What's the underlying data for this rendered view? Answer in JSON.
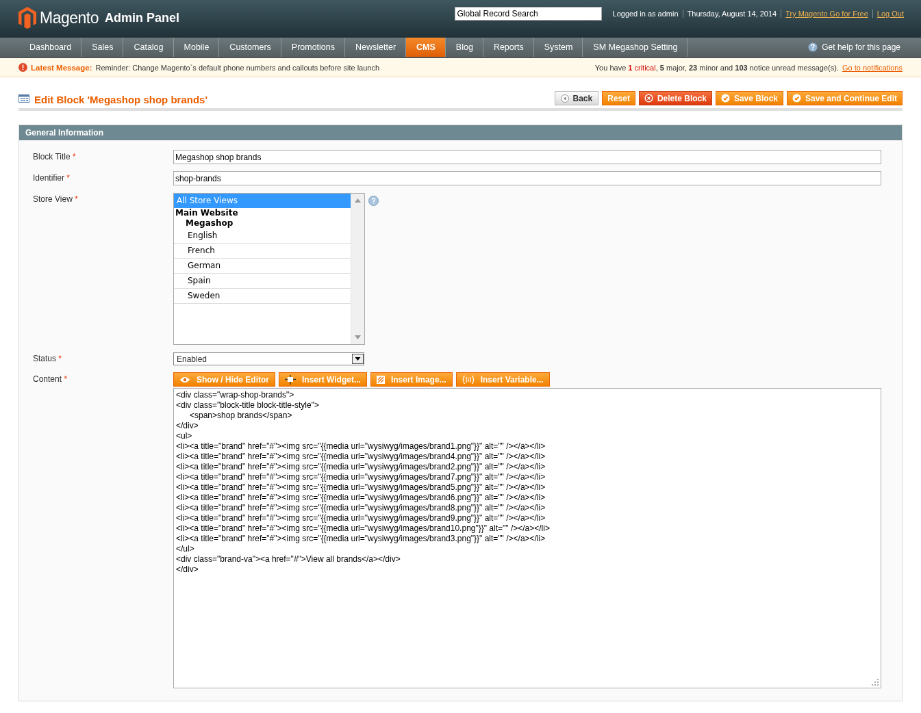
{
  "header": {
    "logo_text": "Magento",
    "logo_suffix": "Admin Panel",
    "search": {
      "placeholder": "Global Record Search"
    },
    "user_text": "Logged in as admin",
    "date": "Thursday, August 14, 2014",
    "links": [
      "Try Magento Go for Free",
      "Log Out"
    ]
  },
  "nav": {
    "items": [
      {
        "label": "Dashboard",
        "selected": false
      },
      {
        "label": "Sales",
        "selected": false
      },
      {
        "label": "Catalog",
        "selected": false
      },
      {
        "label": "Mobile",
        "selected": false
      },
      {
        "label": "Customers",
        "selected": false
      },
      {
        "label": "Promotions",
        "selected": false
      },
      {
        "label": "Newsletter",
        "selected": false
      },
      {
        "label": "CMS",
        "selected": true
      },
      {
        "label": "Blog",
        "selected": false
      },
      {
        "label": "Reports",
        "selected": false
      },
      {
        "label": "System",
        "selected": false
      },
      {
        "label": "SM Megashop Setting",
        "selected": false
      }
    ],
    "help": "Get help for this page"
  },
  "message_bar": {
    "label": "Latest Message:",
    "text": "Reminder: Change Magento`s default phone numbers and callouts before site launch",
    "summary_start": "You have ",
    "critical": "**1** critical",
    "summary_end": ", **5** major, **23** minor and **103** notice unread message(s).",
    "link": "Go to notifications"
  },
  "page": {
    "title": "Edit Block 'Megashop shop brands'",
    "buttons": [
      {
        "label": "Back",
        "kind": "back"
      },
      {
        "label": "Reset",
        "kind": "plain"
      },
      {
        "label": "Delete Block",
        "kind": "delete"
      },
      {
        "label": "Save Block",
        "kind": "save"
      },
      {
        "label": "Save and Continue Edit",
        "kind": "save"
      }
    ]
  },
  "section": {
    "title": "General Information",
    "block_title": {
      "label": "Block Title",
      "value": "Megashop shop brands"
    },
    "identifier": {
      "label": "Identifier",
      "value": "shop-brands"
    },
    "store_view": {
      "label": "Store View",
      "options": [
        {
          "label": "All Store Views",
          "kind": "option",
          "selected": true
        },
        {
          "label": "Main Website",
          "kind": "group",
          "children": [
            {
              "label": "Megashop",
              "kind": "group",
              "children": [
                {
                  "label": "English",
                  "kind": "option",
                  "selected": false
                },
                {
                  "label": "French",
                  "kind": "option",
                  "selected": false
                },
                {
                  "label": "German",
                  "kind": "option",
                  "selected": false
                },
                {
                  "label": "Spain",
                  "kind": "option",
                  "selected": false
                },
                {
                  "label": "Sweden",
                  "kind": "option",
                  "selected": false
                }
              ]
            }
          ]
        }
      ]
    },
    "status": {
      "label": "Status",
      "value": "Enabled"
    },
    "content": {
      "label": "Content",
      "buttons": [
        {
          "label": "Show / Hide Editor",
          "kind": "eye"
        },
        {
          "label": "Insert Widget...",
          "kind": "widget"
        },
        {
          "label": "Insert Image...",
          "kind": "image"
        },
        {
          "label": "Insert Variable...",
          "kind": "variable"
        }
      ],
      "value": "<div class=\"wrap-shop-brands\">\n<div class=\"block-title block-title-style\">\n\t<span>shop brands</span>\n</div>\n<ul>\n<li><a title=\"brand\" href=\"#\"><img src=\"{{media url=\"wysiwyg/images/brand1.png\"}}\" alt=\"\" /></a></li>\n<li><a title=\"brand\" href=\"#\"><img src=\"{{media url=\"wysiwyg/images/brand4.png\"}}\" alt=\"\" /></a></li>\n<li><a title=\"brand\" href=\"#\"><img src=\"{{media url=\"wysiwyg/images/brand2.png\"}}\" alt=\"\" /></a></li>\n<li><a title=\"brand\" href=\"#\"><img src=\"{{media url=\"wysiwyg/images/brand7.png\"}}\" alt=\"\" /></a></li>\n<li><a title=\"brand\" href=\"#\"><img src=\"{{media url=\"wysiwyg/images/brand5.png\"}}\" alt=\"\" /></a></li>\n<li><a title=\"brand\" href=\"#\"><img src=\"{{media url=\"wysiwyg/images/brand6.png\"}}\" alt=\"\" /></a></li>\n<li><a title=\"brand\" href=\"#\"><img src=\"{{media url=\"wysiwyg/images/brand8.png\"}}\" alt=\"\" /></a></li>\n<li><a title=\"brand\" href=\"#\"><img src=\"{{media url=\"wysiwyg/images/brand9.png\"}}\" alt=\"\" /></a></li>\n<li><a title=\"brand\" href=\"#\"><img src=\"{{media url=\"wysiwyg/images/brand10.png\"}}\" alt=\"\" /></a></li>\n<li><a title=\"brand\" href=\"#\"><img src=\"{{media url=\"wysiwyg/images/brand3.png\"}}\" alt=\"\" /></a></li>\n</ul>\n<div class=\"brand-va\"><a href=\"#\">View all brands</a></div>\n</div>"
    }
  },
  "required_mark": "*"
}
